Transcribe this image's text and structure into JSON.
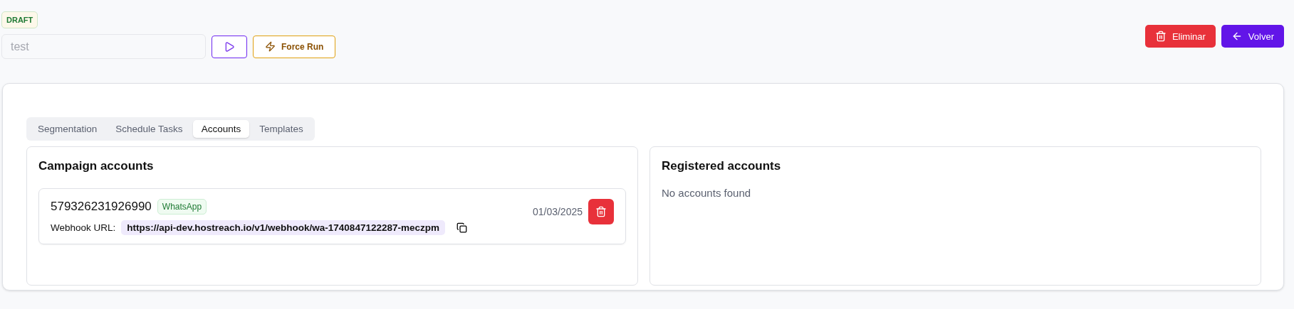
{
  "status_badge": "DRAFT",
  "name_field": {
    "placeholder": "test"
  },
  "actions": [
    {
      "kind": "play"
    },
    {
      "kind": "force",
      "label": "Force Run"
    }
  ],
  "header_buttons": [
    {
      "kind": "delete",
      "label": "Eliminar"
    },
    {
      "kind": "back",
      "label": "Volver"
    }
  ],
  "tabs": [
    {
      "label": "Segmentation",
      "selected": false
    },
    {
      "label": "Schedule Tasks",
      "selected": false
    },
    {
      "label": "Accounts",
      "selected": true
    },
    {
      "label": "Templates",
      "selected": false
    }
  ],
  "campaign_accounts": {
    "title": "Campaign accounts",
    "accounts": [
      {
        "number": "579326231926990",
        "channel": "WhatsApp",
        "webhook_label": "Webhook URL:",
        "webhook_url": "https://api-dev.hostreach.io/v1/webhook/wa-1740847122287-meczpm",
        "date": "01/03/2025"
      }
    ]
  },
  "registered_accounts": {
    "title": "Registered accounts",
    "empty_text": "No accounts found"
  }
}
